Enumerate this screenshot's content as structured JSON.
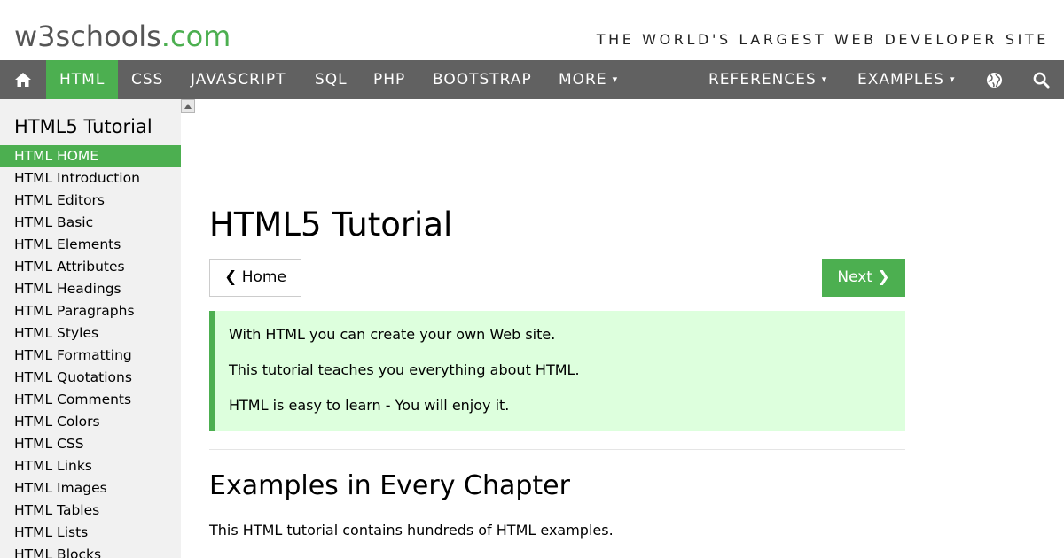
{
  "header": {
    "logo_main": "w3schools",
    "logo_suffix": ".com",
    "tagline": "THE WORLD'S LARGEST WEB DEVELOPER SITE"
  },
  "nav": {
    "items": [
      {
        "label": "HTML"
      },
      {
        "label": "CSS"
      },
      {
        "label": "JAVASCRIPT"
      },
      {
        "label": "SQL"
      },
      {
        "label": "PHP"
      },
      {
        "label": "BOOTSTRAP"
      },
      {
        "label": "MORE",
        "caret": "▾"
      },
      {
        "label": "REFERENCES",
        "caret": "▾"
      },
      {
        "label": "EXAMPLES",
        "caret": "▾"
      }
    ],
    "icons": {
      "home": "home-icon",
      "globe": "globe-icon",
      "search": "search-icon"
    },
    "colors": {
      "bar": "#616161",
      "active": "#4caf50"
    }
  },
  "sidebar": {
    "title": "HTML5 Tutorial",
    "items": [
      "HTML HOME",
      "HTML Introduction",
      "HTML Editors",
      "HTML Basic",
      "HTML Elements",
      "HTML Attributes",
      "HTML Headings",
      "HTML Paragraphs",
      "HTML Styles",
      "HTML Formatting",
      "HTML Quotations",
      "HTML Comments",
      "HTML Colors",
      "HTML CSS",
      "HTML Links",
      "HTML Images",
      "HTML Tables",
      "HTML Lists",
      "HTML Blocks"
    ]
  },
  "main": {
    "title": "HTML5 Tutorial",
    "prev_label": "❮ Home",
    "next_label": "Next ❯",
    "note": [
      "With HTML you can create your own Web site.",
      "This tutorial teaches you everything about HTML.",
      "HTML is easy to learn - You will enjoy it."
    ],
    "section_title": "Examples in Every Chapter",
    "section_text": "This HTML tutorial contains hundreds of HTML examples."
  }
}
